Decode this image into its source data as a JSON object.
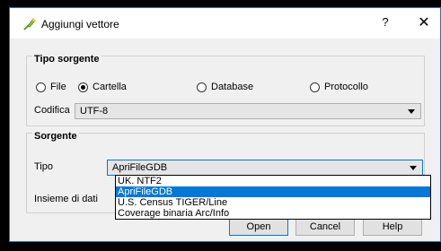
{
  "title": "Aggiungi vettore",
  "title_buttons": {
    "help": "?",
    "close": "✕"
  },
  "source_type": {
    "group_title": "Tipo sorgente",
    "options": [
      {
        "label": "File",
        "checked": false
      },
      {
        "label": "Cartella",
        "checked": true
      },
      {
        "label": "Database",
        "checked": false
      },
      {
        "label": "Protocollo",
        "checked": false
      }
    ],
    "encoding_label": "Codifica",
    "encoding_value": "UTF-8"
  },
  "source": {
    "group_title": "Sorgente",
    "type_label": "Tipo",
    "type_value": "ApriFileGDB",
    "dataset_label": "Insieme di dati",
    "dropdown_options": [
      {
        "label": "UK. NTF2",
        "selected": false
      },
      {
        "label": "ApriFileGDB",
        "selected": true
      },
      {
        "label": "U.S. Census TIGER/Line",
        "selected": false
      },
      {
        "label": "Coverage binaria Arc/Info",
        "selected": false
      }
    ]
  },
  "buttons": {
    "open": "Open",
    "cancel": "Cancel",
    "help": "Help"
  }
}
